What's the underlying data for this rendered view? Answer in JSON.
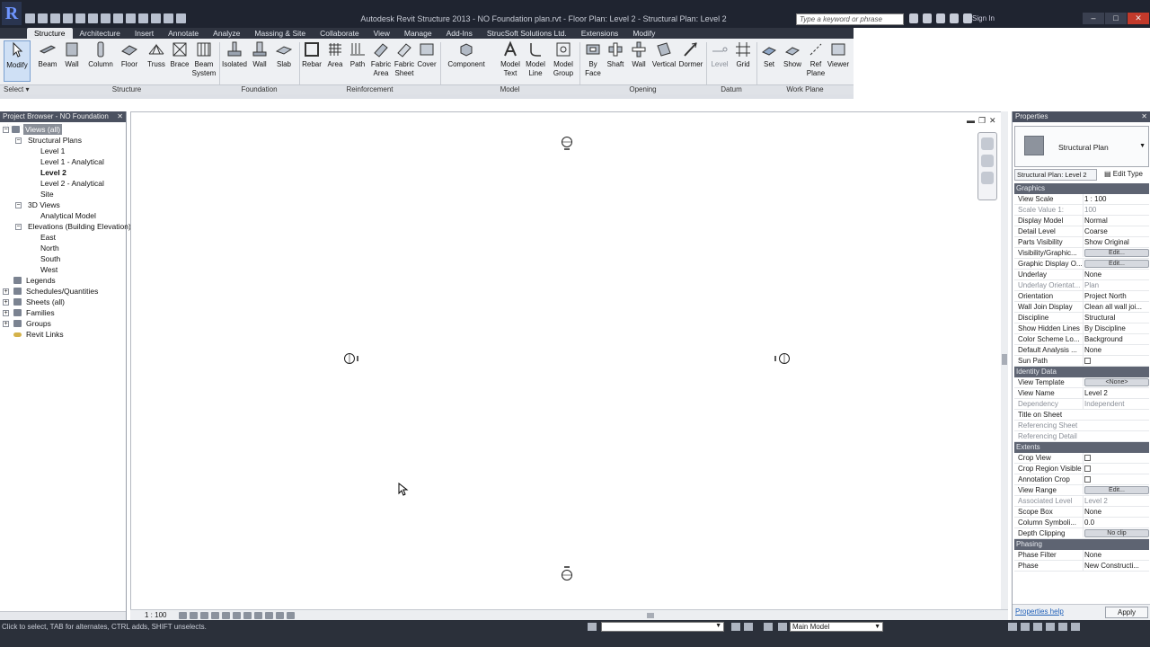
{
  "app": {
    "title": "Autodesk Revit Structure 2013 - NO Foundation plan.rvt - Floor Plan: Level 2 - Structural Plan: Level 2",
    "search_placeholder": "Type a keyword or phrase",
    "user": "Sign In"
  },
  "tabs": [
    "Structure",
    "Architecture",
    "Insert",
    "Annotate",
    "Analyze",
    "Massing & Site",
    "Collaborate",
    "View",
    "Manage",
    "Add-Ins",
    "StrucSoft Solutions Ltd.",
    "Extensions",
    "Modify"
  ],
  "ribbon": {
    "modify": "Modify",
    "select": "Select",
    "structure_buttons": [
      "Beam",
      "Wall",
      "Column",
      "Floor",
      "Truss",
      "Brace",
      "Beam System"
    ],
    "foundation_buttons": [
      "Isolated",
      "Wall",
      "Slab"
    ],
    "reinforcement_buttons": [
      "Rebar",
      "Area",
      "Path",
      "Fabric Area",
      "Fabric Sheet",
      "Cover"
    ],
    "model_buttons": [
      "Component",
      "Model Text",
      "Model Line",
      "Model Group"
    ],
    "opening_buttons": [
      "By Face",
      "Shaft",
      "Wall",
      "Vertical",
      "Dormer"
    ],
    "datum_buttons": [
      "Level",
      "Grid"
    ],
    "workplane_buttons": [
      "Set",
      "Show",
      "Ref Plane",
      "Viewer"
    ],
    "panels": {
      "structure": "Structure",
      "foundation": "Foundation",
      "reinforcement": "Reinforcement",
      "model": "Model",
      "opening": "Opening",
      "datum": "Datum",
      "workplane": "Work Plane"
    }
  },
  "browser": {
    "header": "Project Browser - NO Foundation plan.rvt",
    "root": "Views (all)",
    "structural_plans": "Structural Plans",
    "plans": [
      "Level 1",
      "Level 1 - Analytical",
      "Level 2",
      "Level 2 - Analytical",
      "Site"
    ],
    "views3d": "3D Views",
    "views3d_items": [
      "Analytical Model"
    ],
    "elevations": "Elevations (Building Elevation)",
    "elevation_items": [
      "East",
      "North",
      "South",
      "West"
    ],
    "legends": "Legends",
    "schedules": "Schedules/Quantities",
    "sheets": "Sheets (all)",
    "families": "Families",
    "groups": "Groups",
    "links": "Revit Links"
  },
  "viewbar": {
    "scale": "1 : 100"
  },
  "properties": {
    "header": "Properties",
    "type_name": "Structural Plan",
    "instance": "Structural Plan: Level 2",
    "edit_type": "Edit Type",
    "groups": {
      "graphics": "Graphics",
      "identity": "Identity Data",
      "extents": "Extents",
      "phasing": "Phasing"
    },
    "graphics_rows": [
      {
        "k": "View Scale",
        "v": "1 : 100"
      },
      {
        "k": "Scale Value    1:",
        "v": "100"
      },
      {
        "k": "Display Model",
        "v": "Normal"
      },
      {
        "k": "Detail Level",
        "v": "Coarse"
      },
      {
        "k": "Parts Visibility",
        "v": "Show Original"
      },
      {
        "k": "Visibility/Graphic...",
        "v": "Edit..."
      },
      {
        "k": "Graphic Display O...",
        "v": "Edit..."
      },
      {
        "k": "Underlay",
        "v": "None"
      },
      {
        "k": "Underlay Orientat...",
        "v": "Plan"
      },
      {
        "k": "Orientation",
        "v": "Project North"
      },
      {
        "k": "Wall Join Display",
        "v": "Clean all wall joi..."
      },
      {
        "k": "Discipline",
        "v": "Structural"
      },
      {
        "k": "Show Hidden Lines",
        "v": "By Discipline"
      },
      {
        "k": "Color Scheme Lo...",
        "v": "Background"
      },
      {
        "k": "Default Analysis ...",
        "v": "None"
      },
      {
        "k": "Sun Path",
        "v": ""
      }
    ],
    "identity_rows": [
      {
        "k": "View Template",
        "v": "<None>"
      },
      {
        "k": "View Name",
        "v": "Level 2"
      },
      {
        "k": "Dependency",
        "v": "Independent"
      },
      {
        "k": "Title on Sheet",
        "v": ""
      },
      {
        "k": "Referencing Sheet",
        "v": ""
      },
      {
        "k": "Referencing Detail",
        "v": ""
      }
    ],
    "extents_rows": [
      {
        "k": "Crop View",
        "v": ""
      },
      {
        "k": "Crop Region Visible",
        "v": ""
      },
      {
        "k": "Annotation Crop",
        "v": ""
      },
      {
        "k": "View Range",
        "v": "Edit..."
      },
      {
        "k": "Associated Level",
        "v": "Level 2"
      },
      {
        "k": "Scope Box",
        "v": "None"
      },
      {
        "k": "Column Symboli...",
        "v": "0.0"
      },
      {
        "k": "Depth Clipping",
        "v": "No clip"
      }
    ],
    "phasing_rows": [
      {
        "k": "Phase Filter",
        "v": "None"
      },
      {
        "k": "Phase",
        "v": "New Constructi..."
      }
    ],
    "help": "Properties help",
    "apply": "Apply"
  },
  "status": {
    "message": "Click to select, TAB for alternates, CTRL adds, SHIFT unselects.",
    "workset": "",
    "design_option": "Main Model"
  }
}
